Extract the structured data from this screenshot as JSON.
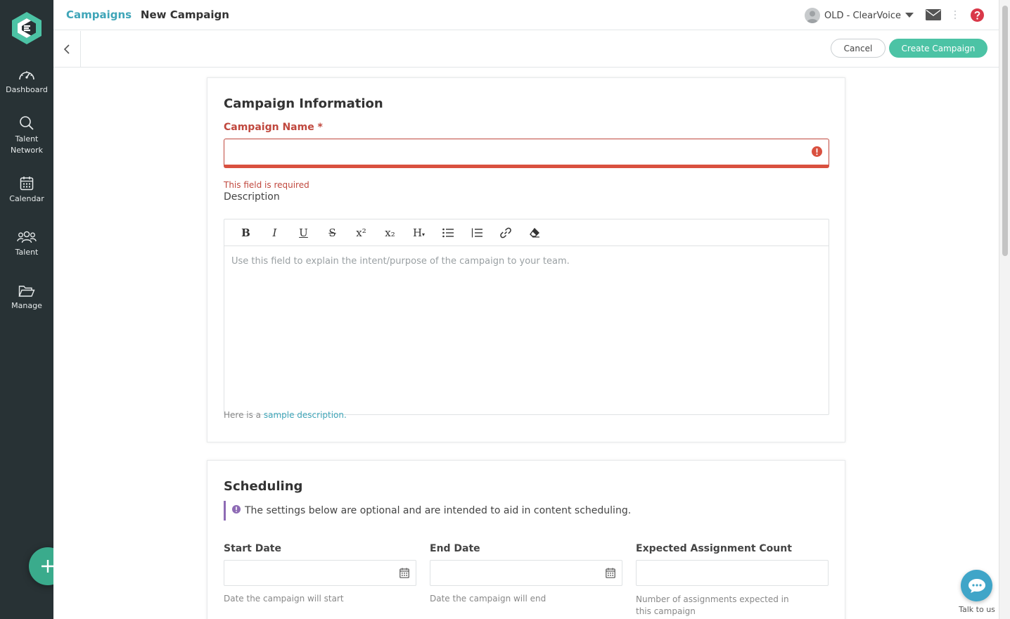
{
  "sidebar": {
    "items": [
      {
        "label": "Dashboard"
      },
      {
        "label": "Talent Network"
      },
      {
        "label": "Calendar"
      },
      {
        "label": "Talent"
      },
      {
        "label": "Manage"
      }
    ]
  },
  "header": {
    "breadcrumb_parent": "Campaigns",
    "breadcrumb_current": "New Campaign",
    "account_name": "OLD - ClearVoice"
  },
  "toolbar": {
    "cancel_label": "Cancel",
    "create_label": "Create Campaign"
  },
  "campaign_info": {
    "title": "Campaign Information",
    "name_label": "Campaign Name *",
    "name_value": "",
    "name_error": "This field is required",
    "description_label": "Description",
    "description_placeholder": "Use this field to explain the intent/purpose of the campaign to your team.",
    "hint_prefix": "Here is a ",
    "hint_link": "sample description."
  },
  "scheduling": {
    "title": "Scheduling",
    "note": "The settings below are optional and are intended to aid in content scheduling.",
    "start_label": "Start Date",
    "start_hint": "Date the campaign will start",
    "end_label": "End Date",
    "end_hint": "Date the campaign will end",
    "count_label": "Expected Assignment Count",
    "count_hint": "Number of assignments expected in this campaign"
  },
  "chat": {
    "label": "Talk to us"
  },
  "colors": {
    "sidebar": "#283235",
    "accent_teal": "#4cc3a5",
    "link": "#3fa5b8",
    "error": "#c0483e",
    "help": "#d93849",
    "note_bar": "#8e6bb5"
  }
}
